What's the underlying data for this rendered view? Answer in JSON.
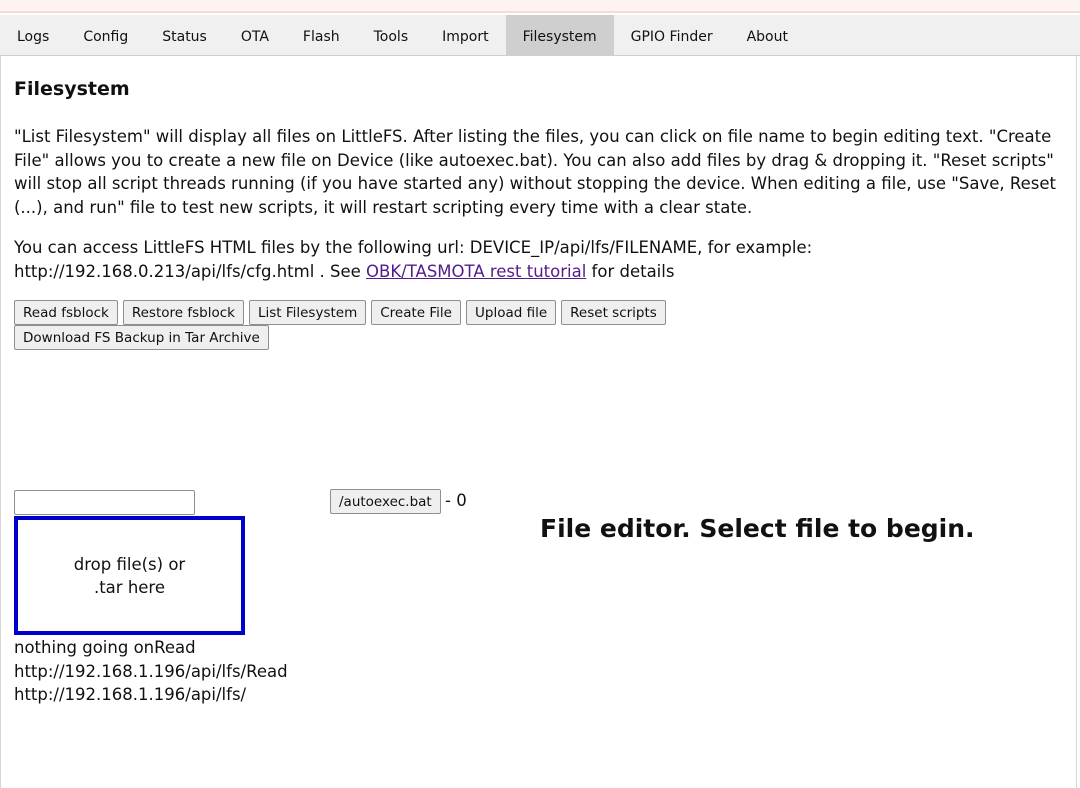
{
  "tabs": [
    "Logs",
    "Config",
    "Status",
    "OTA",
    "Flash",
    "Tools",
    "Import",
    "Filesystem",
    "GPIO Finder",
    "About"
  ],
  "active_tab": "Filesystem",
  "page": {
    "title": "Filesystem",
    "description": "\"List Filesystem\" will display all files on LittleFS. After listing the files, you can click on file name to begin editing text. \"Create File\" allows you to create a new file on Device (like autoexec.bat). You can also add files by drag & dropping it. \"Reset scripts\" will stop all script threads running (if you have started any) without stopping the device. When editing a file, use \"Save, Reset (...), and run\" file to test new scripts, it will restart scripting every time with a clear state.",
    "url_info_prefix": "You can access LittleFS HTML files by the following url: DEVICE_IP/api/lfs/FILENAME, for example: http://192.168.0.213/api/lfs/cfg.html . See ",
    "url_info_link": "OBK/TASMOTA rest tutorial",
    "url_info_suffix": " for details"
  },
  "buttons": {
    "read_fsblock": "Read fsblock",
    "restore_fsblock": "Restore fsblock",
    "list_filesystem": "List Filesystem",
    "create_file": "Create File",
    "upload_file": "Upload file",
    "reset_scripts": "Reset scripts",
    "download_backup": "Download FS Backup in Tar Archive"
  },
  "filename_input": {
    "value": ""
  },
  "dropzone": {
    "text": "drop file(s) or .tar here"
  },
  "file_list": [
    {
      "name": "/autoexec.bat",
      "size": "- 0"
    }
  ],
  "editor": {
    "placeholder_title": "File editor. Select file to begin."
  },
  "status_lines": [
    "nothing going onRead",
    "http://192.168.1.196/api/lfs/Read",
    "http://192.168.1.196/api/lfs/"
  ]
}
